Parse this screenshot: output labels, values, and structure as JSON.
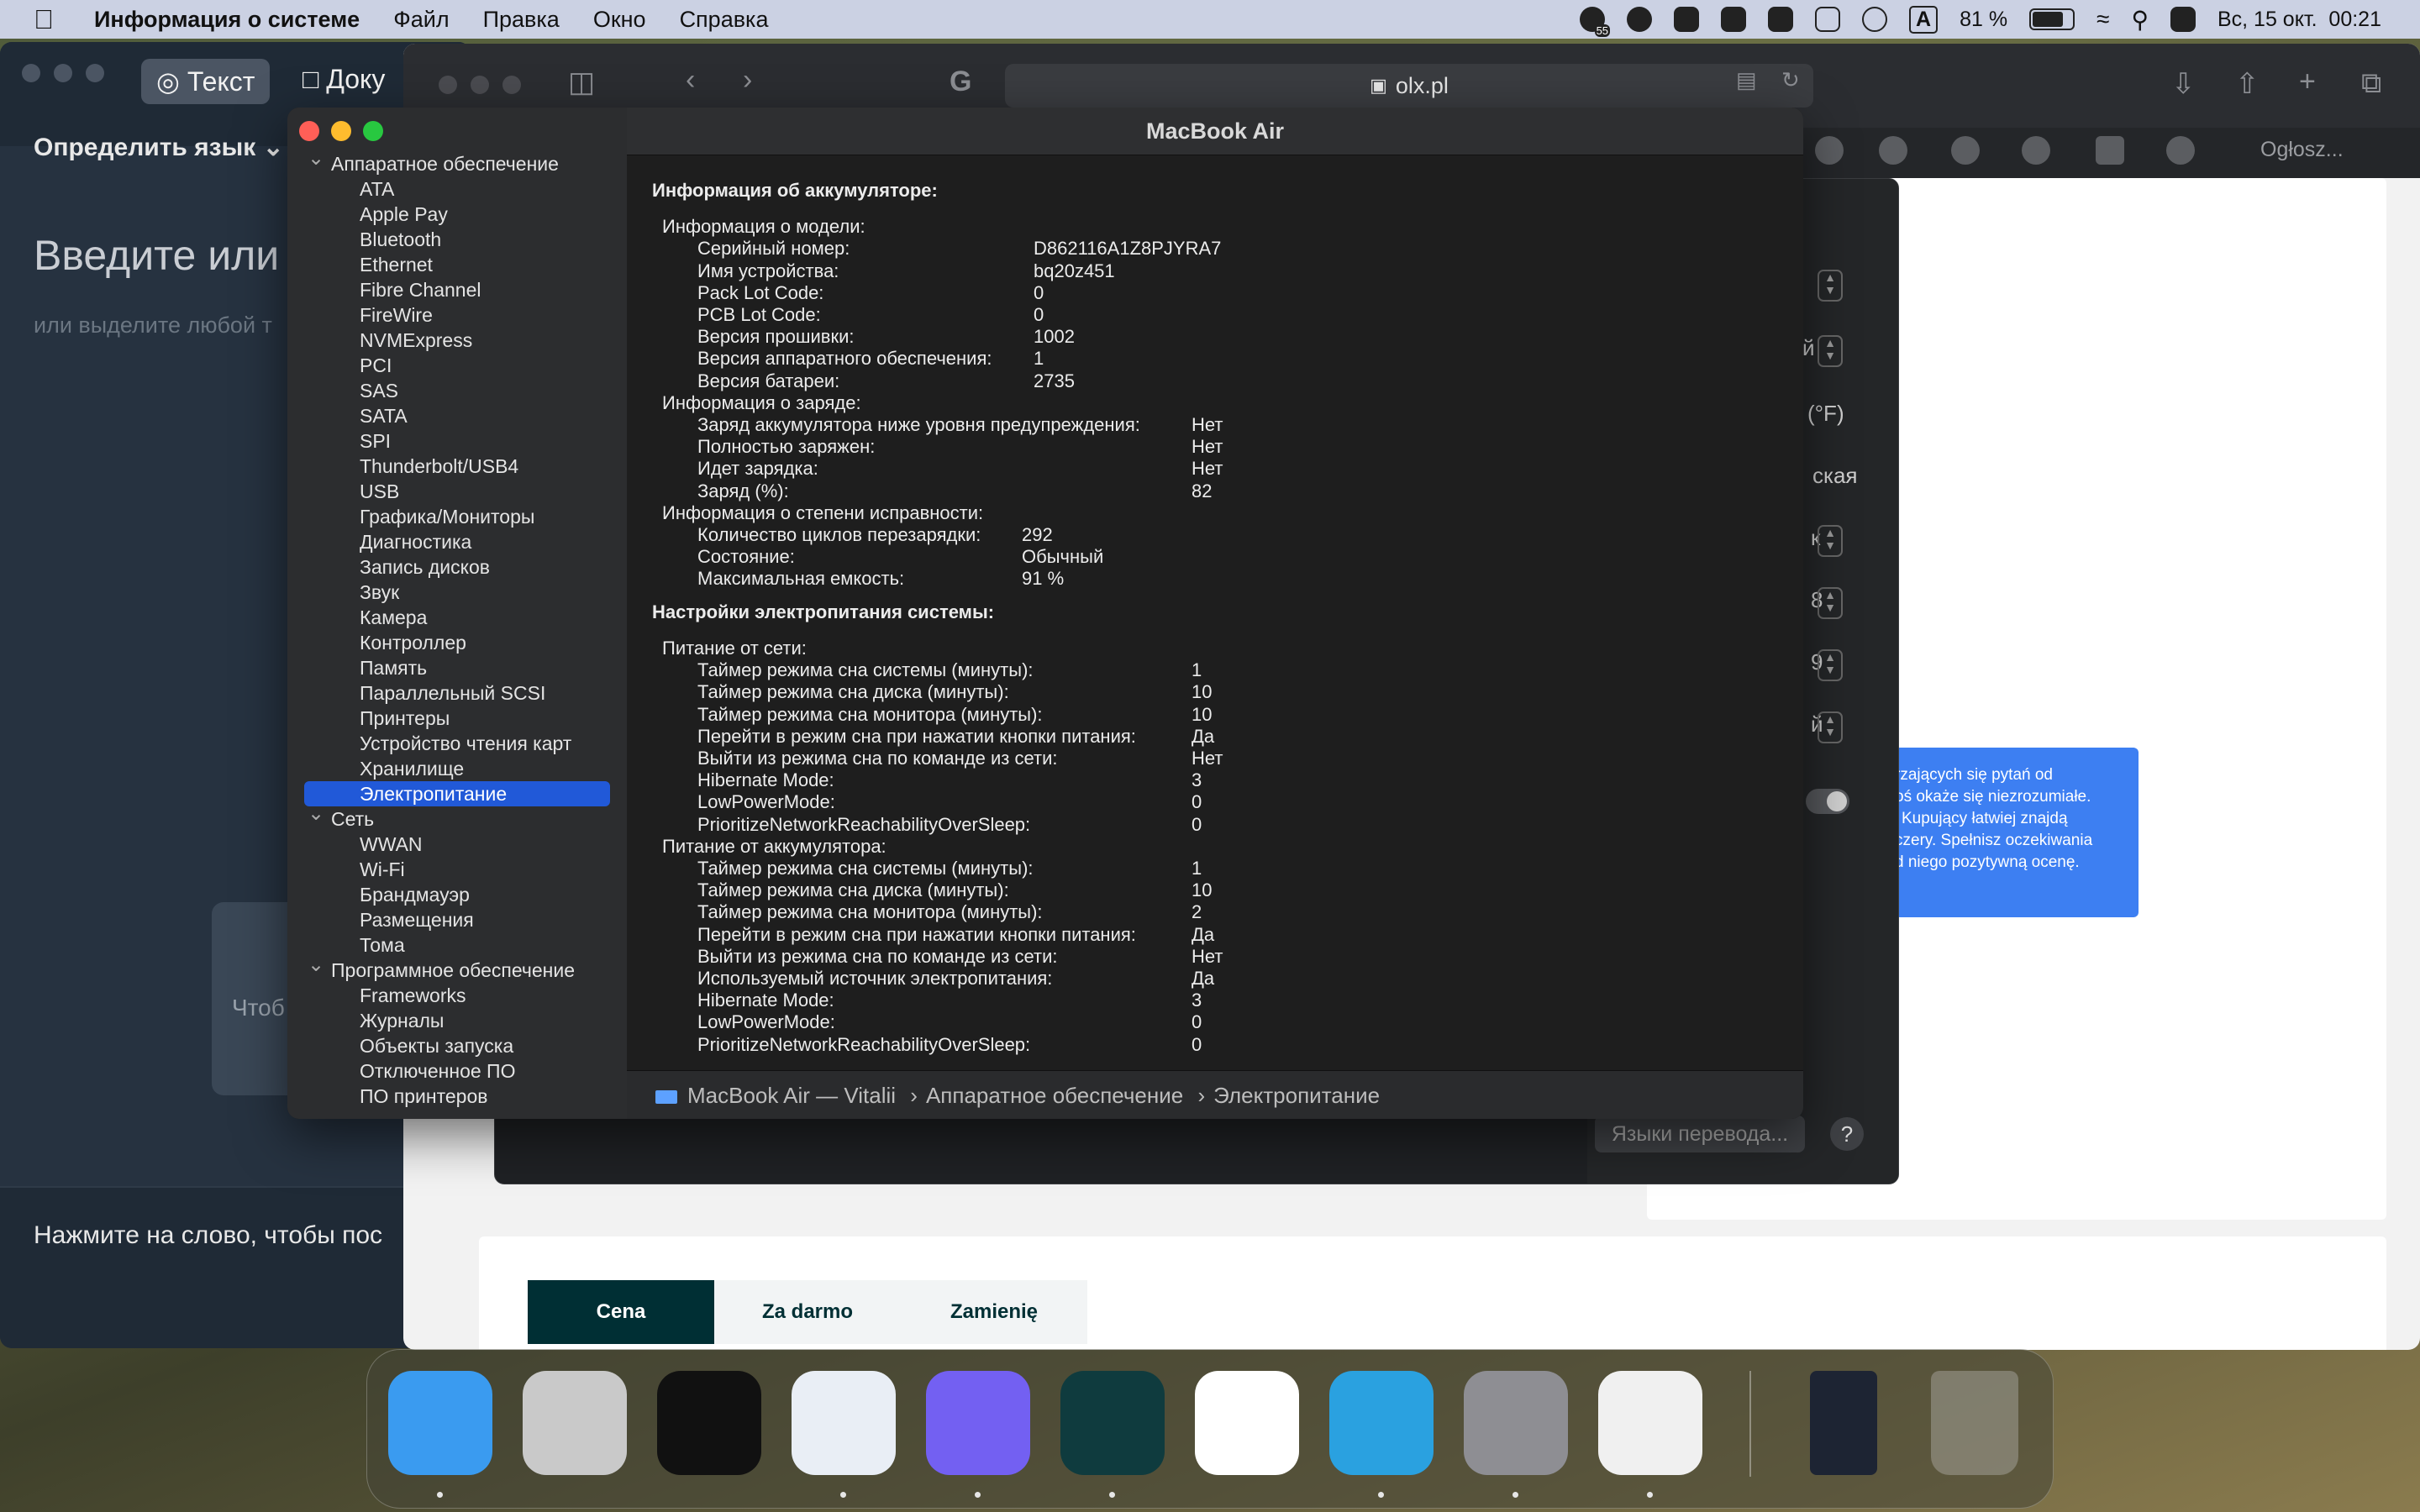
{
  "menubar": {
    "app_name": "Информация о системе",
    "items": [
      "Файл",
      "Правка",
      "Окно",
      "Справка"
    ],
    "battery_percent": "81 %",
    "battery_level": 0.81,
    "datetime": "Вс, 15 окт.  00:21",
    "badge_count": "55",
    "input_source": "A"
  },
  "translator": {
    "tab_text": "Текст",
    "tab_docs": "Доку",
    "detect_language": "Определить язык",
    "input_heading": "Введите или",
    "input_sub": "или выделите любой т",
    "card_text": "Чтоб",
    "hint": "Нажмите на слово, чтобы пос"
  },
  "browser": {
    "url": "olx.pl",
    "tab_label": "Ogłosz...",
    "blue_tip": [
      "rzających się pytań od",
      "oś okaże się niezrozumiałe.",
      "Kupujący łatwiej znajdą",
      "czery. Spełnisz oczekiwania",
      "d niego pozytywną ocenę."
    ],
    "segments": [
      "Cena",
      "Za darmo",
      "Zamienię"
    ]
  },
  "translator_popup": {
    "side_texts": [
      "й",
      "(°F)",
      "ская",
      "к",
      "8",
      "9",
      "й"
    ],
    "languages_button": "Языки перевода...",
    "help": "?"
  },
  "sysinfo": {
    "window_title": "MacBook Air",
    "sidebar": [
      {
        "label": "Аппаратное обеспечение",
        "kind": "cat"
      },
      {
        "label": "ATA",
        "kind": "item"
      },
      {
        "label": "Apple Pay",
        "kind": "item"
      },
      {
        "label": "Bluetooth",
        "kind": "item"
      },
      {
        "label": "Ethernet",
        "kind": "item"
      },
      {
        "label": "Fibre Channel",
        "kind": "item"
      },
      {
        "label": "FireWire",
        "kind": "item"
      },
      {
        "label": "NVMExpress",
        "kind": "item"
      },
      {
        "label": "PCI",
        "kind": "item"
      },
      {
        "label": "SAS",
        "kind": "item"
      },
      {
        "label": "SATA",
        "kind": "item"
      },
      {
        "label": "SPI",
        "kind": "item"
      },
      {
        "label": "Thunderbolt/USB4",
        "kind": "item"
      },
      {
        "label": "USB",
        "kind": "item"
      },
      {
        "label": "Графика/Мониторы",
        "kind": "item"
      },
      {
        "label": "Диагностика",
        "kind": "item"
      },
      {
        "label": "Запись дисков",
        "kind": "item"
      },
      {
        "label": "Звук",
        "kind": "item"
      },
      {
        "label": "Камера",
        "kind": "item"
      },
      {
        "label": "Контроллер",
        "kind": "item"
      },
      {
        "label": "Память",
        "kind": "item"
      },
      {
        "label": "Параллельный SCSI",
        "kind": "item"
      },
      {
        "label": "Принтеры",
        "kind": "item"
      },
      {
        "label": "Устройство чтения карт",
        "kind": "item"
      },
      {
        "label": "Хранилище",
        "kind": "item"
      },
      {
        "label": "Электропитание",
        "kind": "sel"
      },
      {
        "label": "Сеть",
        "kind": "cat"
      },
      {
        "label": "WWAN",
        "kind": "item"
      },
      {
        "label": "Wi-Fi",
        "kind": "item"
      },
      {
        "label": "Брандмауэр",
        "kind": "item"
      },
      {
        "label": "Размещения",
        "kind": "item"
      },
      {
        "label": "Тома",
        "kind": "item"
      },
      {
        "label": "Программное обеспечение",
        "kind": "cat"
      },
      {
        "label": "Frameworks",
        "kind": "item"
      },
      {
        "label": "Журналы",
        "kind": "item"
      },
      {
        "label": "Объекты запуска",
        "kind": "item"
      },
      {
        "label": "Отключенное ПО",
        "kind": "item"
      },
      {
        "label": "ПО принтеров",
        "kind": "item"
      }
    ],
    "battery": {
      "heading": "Информация об аккумуляторе:",
      "model_header": "Информация о модели:",
      "model": [
        {
          "k": "Серийный номер:",
          "v": "D862116A1Z8PJYRA7"
        },
        {
          "k": "Имя устройства:",
          "v": "bq20z451"
        },
        {
          "k": "Pack Lot Code:",
          "v": "0"
        },
        {
          "k": "PCB Lot Code:",
          "v": "0"
        },
        {
          "k": "Версия прошивки:",
          "v": "1002"
        },
        {
          "k": "Версия аппаратного обеспечения:",
          "v": "1"
        },
        {
          "k": "Версия батареи:",
          "v": "2735"
        }
      ],
      "charge_header": "Информация о заряде:",
      "charge": [
        {
          "k": "Заряд аккумулятора ниже уровня предупреждения:",
          "v": "Нет"
        },
        {
          "k": "Полностью заряжен:",
          "v": "Нет"
        },
        {
          "k": "Идет зарядка:",
          "v": "Нет"
        },
        {
          "k": "Заряд (%):",
          "v": "82"
        }
      ],
      "health_header": "Информация о степени исправности:",
      "health": [
        {
          "k": "Количество циклов перезарядки:",
          "v": "292"
        },
        {
          "k": "Состояние:",
          "v": "Обычный"
        },
        {
          "k": "Максимальная емкость:",
          "v": "91 %"
        }
      ]
    },
    "power": {
      "heading": "Настройки электропитания системы:",
      "ac_header": "Питание от сети:",
      "ac": [
        {
          "k": "Таймер режима сна системы (минуты):",
          "v": "1"
        },
        {
          "k": "Таймер режима сна диска (минуты):",
          "v": "10"
        },
        {
          "k": "Таймер режима сна монитора (минуты):",
          "v": "10"
        },
        {
          "k": "Перейти в режим сна при нажатии кнопки питания:",
          "v": "Да"
        },
        {
          "k": "Выйти из режима сна по команде из сети:",
          "v": "Нет"
        },
        {
          "k": "Hibernate Mode:",
          "v": "3"
        },
        {
          "k": "LowPowerMode:",
          "v": "0"
        },
        {
          "k": "PrioritizeNetworkReachabilityOverSleep:",
          "v": "0"
        }
      ],
      "batt_header": "Питание от аккумулятора:",
      "batt": [
        {
          "k": "Таймер режима сна системы (минуты):",
          "v": "1"
        },
        {
          "k": "Таймер режима сна диска (минуты):",
          "v": "10"
        },
        {
          "k": "Таймер режима сна монитора (минуты):",
          "v": "2"
        },
        {
          "k": "Перейти в режим сна при нажатии кнопки питания:",
          "v": "Да"
        },
        {
          "k": "Выйти из режима сна по команде из сети:",
          "v": "Нет"
        },
        {
          "k": "Используемый источник электропитания:",
          "v": "Да"
        },
        {
          "k": "Hibernate Mode:",
          "v": "3"
        },
        {
          "k": "LowPowerMode:",
          "v": "0"
        },
        {
          "k": "PrioritizeNetworkReachabilityOverSleep:",
          "v": "0"
        }
      ]
    },
    "path": {
      "computer": "MacBook Air — Vitalii",
      "section": "Аппаратное обеспечение",
      "item": "Электропитание",
      "sep": "›"
    }
  },
  "dock": {
    "apps": [
      {
        "name": "finder-icon",
        "color": "#3a9bf0"
      },
      {
        "name": "launchpad-icon",
        "color": "#c9c9c9"
      },
      {
        "name": "app-grid-icon",
        "color": "#111111"
      },
      {
        "name": "safari-icon",
        "color": "#e9eef5"
      },
      {
        "name": "viber-icon",
        "color": "#7360f2"
      },
      {
        "name": "app-bot-icon",
        "color": "#0f3b3e"
      },
      {
        "name": "share-hex-icon",
        "color": "#ffffff"
      },
      {
        "name": "telegram-icon",
        "color": "#2aa1e0"
      },
      {
        "name": "system-settings-icon",
        "color": "#8e8e93"
      },
      {
        "name": "chip-tool-icon",
        "color": "#f0f0f0"
      }
    ]
  }
}
